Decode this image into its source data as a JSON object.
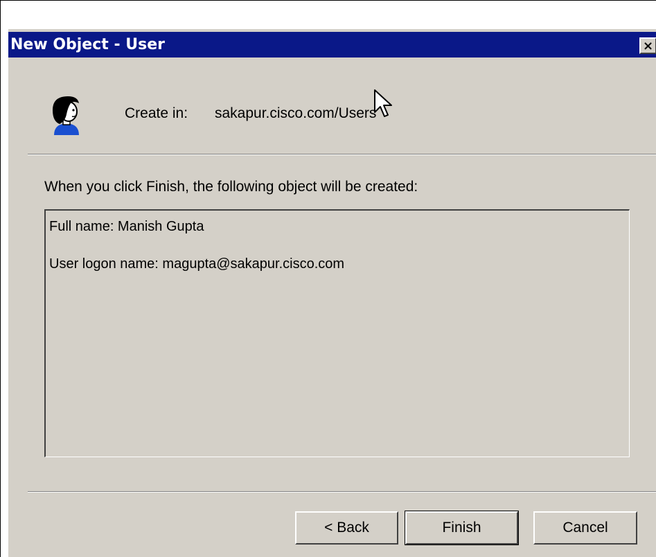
{
  "window": {
    "title": "New Object - User",
    "close_glyph": "×"
  },
  "header": {
    "icon": "user-icon",
    "create_in_label": "Create in:",
    "create_in_value": "sakapur.cisco.com/Users"
  },
  "body": {
    "info_label": "When you click Finish, the following object will be created:",
    "summary": [
      "Full name: Manish Gupta",
      "User logon name: magupta@sakapur.cisco.com"
    ]
  },
  "buttons": {
    "back_label": "< Back",
    "finish_label": "Finish",
    "cancel_label": "Cancel"
  },
  "colors": {
    "titlebar": "#0a1888",
    "dialog_face": "#d4d0c8"
  }
}
